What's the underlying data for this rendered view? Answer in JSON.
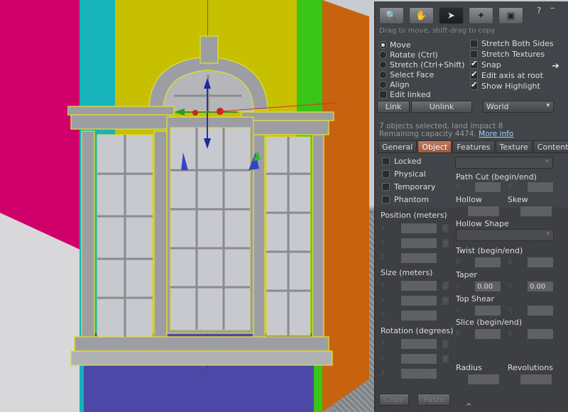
{
  "colors": {
    "panel_bg": "#37393d",
    "active_tab": "#c57a5a",
    "link": "#9fd2ff",
    "walls": [
      "#d0006b",
      "#16b3ba",
      "#c7c000",
      "#3ac415",
      "#c7620f",
      "#4d47a8"
    ]
  },
  "toolbar": {
    "tools": [
      {
        "icon": "magnifier-icon",
        "label": "Focus"
      },
      {
        "icon": "hand-icon",
        "label": "Move"
      },
      {
        "icon": "pointer-icon",
        "label": "Edit"
      },
      {
        "icon": "wand-icon",
        "label": "Create"
      },
      {
        "icon": "bulldozer-icon",
        "label": "Land"
      }
    ],
    "help": "?",
    "minimize": "–",
    "hint": "Drag to move, shift-drag to copy"
  },
  "modes": [
    {
      "label": "Move",
      "selected": true
    },
    {
      "label": "Rotate (Ctrl)",
      "selected": false
    },
    {
      "label": "Stretch (Ctrl+Shift)",
      "selected": false
    },
    {
      "label": "Select Face",
      "selected": false
    },
    {
      "label": "Align",
      "selected": false
    }
  ],
  "edit_linked": {
    "label": "Edit linked",
    "checked": false
  },
  "options": [
    {
      "label": "Stretch Both Sides",
      "checked": false
    },
    {
      "label": "Stretch Textures",
      "checked": false
    },
    {
      "label": "Snap",
      "checked": true
    },
    {
      "label": "Edit axis at root",
      "checked": true
    },
    {
      "label": "Show Highlight",
      "checked": true
    }
  ],
  "link_buttons": {
    "link": "Link",
    "unlink": "Unlink"
  },
  "ruler": {
    "selected": "World",
    "caret": "▾"
  },
  "selection": {
    "line1": "7 objects selected, land impact 8",
    "line2_prefix": "Remaining capacity 4474.",
    "more_info": "More info"
  },
  "tabs": [
    "General",
    "Object",
    "Features",
    "Texture",
    "Content"
  ],
  "active_tab": "Object",
  "object": {
    "flags": [
      {
        "label": "Locked"
      },
      {
        "label": "Physical"
      },
      {
        "label": "Temporary"
      },
      {
        "label": "Phantom"
      }
    ],
    "position_label": "Position (meters)",
    "size_label": "Size (meters)",
    "rotation_label": "Rotation (degrees)",
    "axes": [
      "X",
      "Y",
      "Z"
    ],
    "path_cut": "Path Cut (begin/end)",
    "hollow": "Hollow",
    "skew": "Skew",
    "hollow_shape": "Hollow Shape",
    "twist": "Twist (begin/end)",
    "taper": "Taper",
    "taper_x": "0.00",
    "taper_y": "0.00",
    "top_shear": "Top Shear",
    "slice": "Slice (begin/end)",
    "radius": "Radius",
    "revolutions": "Revolutions",
    "b": "B",
    "e": "E",
    "x": "X",
    "y": "Y",
    "c": "C",
    "p": "P"
  },
  "footer": {
    "copy": "Copy",
    "paste": "Paste",
    "grip": "^"
  }
}
